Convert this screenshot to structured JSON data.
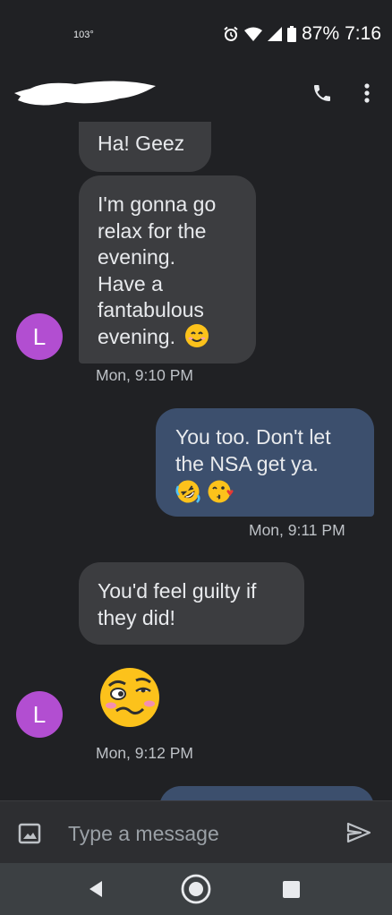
{
  "status_bar": {
    "temperature": "103°",
    "battery": "87%",
    "time": "7:16"
  },
  "header": {
    "contact_name_redacted": true,
    "icons": [
      "phone-icon",
      "more-vert-icon"
    ]
  },
  "messages": [
    {
      "direction": "incoming",
      "text": "Ha! Geez"
    },
    {
      "direction": "incoming",
      "lines": [
        "I'm gonna go",
        "relax for the",
        "evening.",
        "Have a",
        "fantabulous",
        "evening."
      ],
      "emoji": "smiling-face-icon",
      "timestamp": "Mon, 9:10 PM",
      "avatar_letter": "L"
    },
    {
      "direction": "outgoing",
      "lines": [
        "You too. Don't let",
        "the NSA get ya."
      ],
      "emoji": [
        "rolling-laughing-icon",
        "kissing-wink-icon"
      ],
      "timestamp": "Mon, 9:11 PM"
    },
    {
      "direction": "incoming",
      "lines": [
        "You'd feel guilty if",
        "they did!"
      ]
    },
    {
      "direction": "incoming",
      "emoji": "woozy-face-icon",
      "timestamp": "Mon, 9:12 PM",
      "avatar_letter": "L"
    }
  ],
  "composer": {
    "placeholder": "Type a message"
  },
  "colors": {
    "background": "#202124",
    "incoming_bubble": "#3c3d40",
    "outgoing_bubble": "#3c4f6d",
    "avatar": "#b24ed1"
  }
}
